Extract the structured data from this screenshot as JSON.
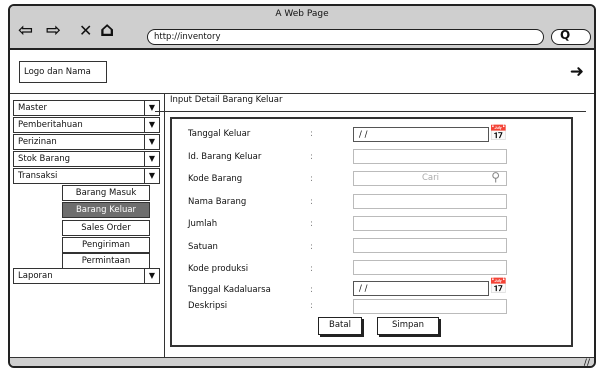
{
  "window": {
    "title": "A Web Page",
    "url": "http://inventory"
  },
  "nav": {
    "back_icon": "⇦",
    "forward_icon": "⇨",
    "close_icon": "✕",
    "home_icon": "⌂",
    "search_icon": "Q"
  },
  "app": {
    "logo_label": "Logo dan Nama",
    "logout_icon": "➜"
  },
  "sidebar": {
    "menus": [
      "Master",
      "Pemberitahuan",
      "Perizinan",
      "Stok Barang",
      "Transaksi"
    ],
    "submenus": [
      "Barang Masuk",
      "Barang Keluar",
      "Sales Order",
      "Pengiriman",
      "Permintaan"
    ],
    "active_submenu": "Barang Keluar",
    "last_menu": "Laporan",
    "arrow": "▼"
  },
  "main": {
    "title": "Input Detail Barang Keluar",
    "colon": ":",
    "fields": {
      "tanggal_keluar": {
        "label": "Tanggal Keluar",
        "value": "/ /"
      },
      "id_barang_keluar": {
        "label": "Id. Barang Keluar",
        "value": ""
      },
      "kode_barang": {
        "label": "Kode Barang",
        "placeholder": "Cari"
      },
      "nama_barang": {
        "label": "Nama Barang",
        "value": ""
      },
      "jumlah": {
        "label": "Jumlah",
        "value": ""
      },
      "satuan": {
        "label": "Satuan",
        "value": ""
      },
      "kode_produksi": {
        "label": "Kode produksi",
        "value": ""
      },
      "tanggal_kadaluarsa": {
        "label": "Tanggal Kadaluarsa",
        "value": "/ /"
      },
      "deskripsi": {
        "label": "Deskripsi",
        "value": ""
      }
    },
    "buttons": {
      "batal": "Batal",
      "simpan": "Simpan"
    }
  }
}
